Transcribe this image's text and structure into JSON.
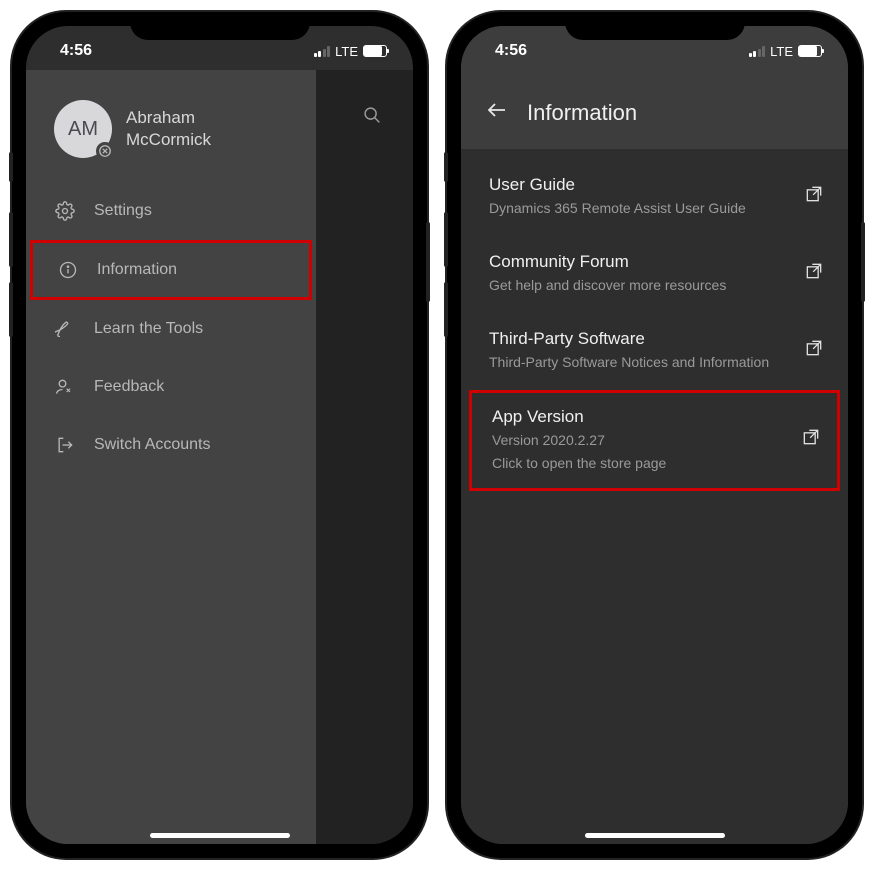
{
  "status": {
    "time": "4:56",
    "network": "LTE"
  },
  "phone1": {
    "profile": {
      "initials": "AM",
      "name_line1": "Abraham",
      "name_line2": "McCormick"
    },
    "menu": {
      "settings": "Settings",
      "information": "Information",
      "learn": "Learn the Tools",
      "feedback": "Feedback",
      "switch": "Switch Accounts"
    }
  },
  "phone2": {
    "header": "Information",
    "items": {
      "userguide": {
        "title": "User Guide",
        "sub": "Dynamics 365 Remote Assist User Guide"
      },
      "forum": {
        "title": "Community Forum",
        "sub": "Get help and discover more resources"
      },
      "thirdparty": {
        "title": "Third-Party Software",
        "sub": "Third-Party Software Notices and Information"
      },
      "appversion": {
        "title": "App Version",
        "sub1": "Version 2020.2.27",
        "sub2": "Click to open the store page"
      }
    }
  }
}
